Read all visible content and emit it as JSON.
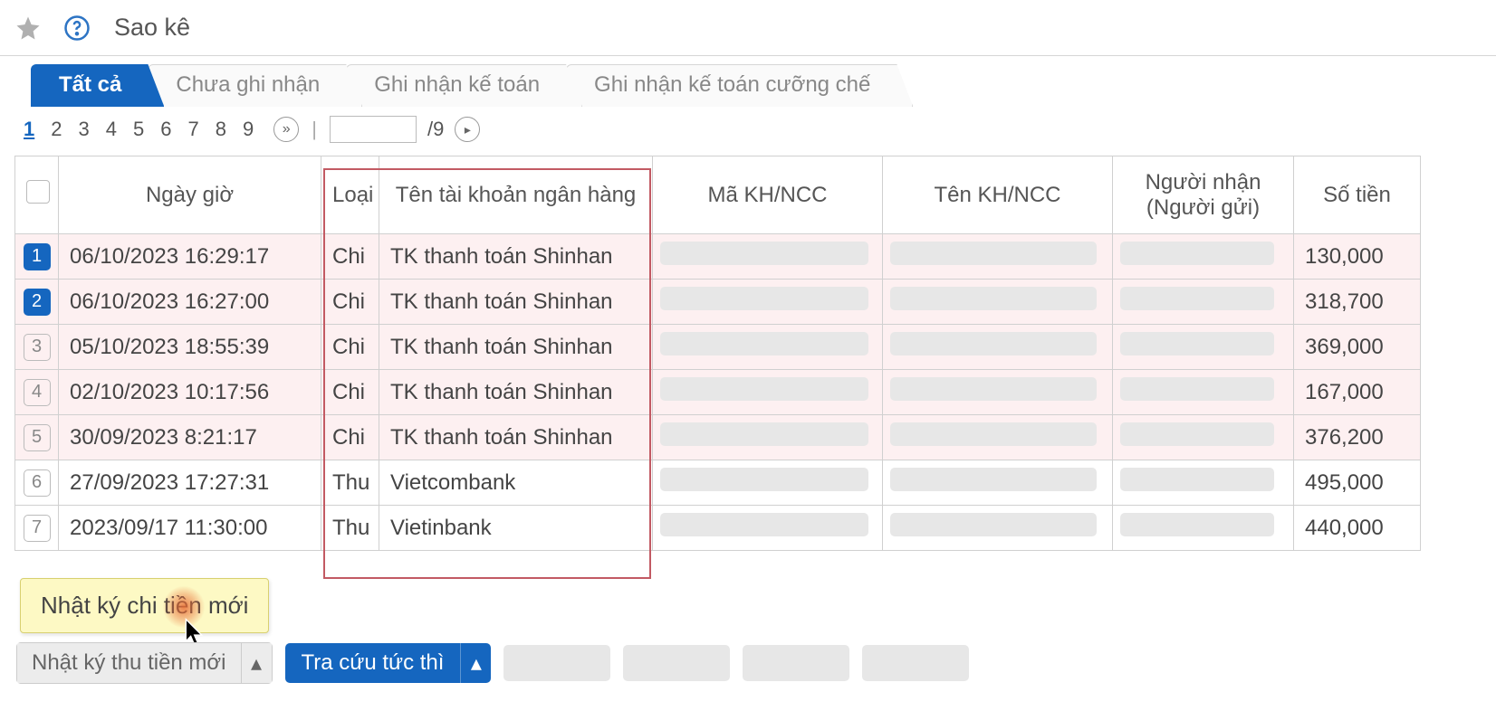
{
  "header": {
    "title": "Sao kê"
  },
  "tabs": [
    "Tất cả",
    "Chưa ghi nhận",
    "Ghi nhận kế toán",
    "Ghi nhận kế toán cưỡng chế"
  ],
  "pagination": {
    "pages": [
      "1",
      "2",
      "3",
      "4",
      "5",
      "6",
      "7",
      "8",
      "9"
    ],
    "active": "1",
    "total": "9",
    "input_value": ""
  },
  "table": {
    "headers": {
      "date": "Ngày giờ",
      "type": "Loại",
      "bank": "Tên tài khoản ngân hàng",
      "code": "Mã KH/NCC",
      "name": "Tên KH/NCC",
      "recv": "Người nhận (Người gửi)",
      "amt": "Số tiền"
    },
    "rows": [
      {
        "n": "1",
        "sel": true,
        "pink": true,
        "date": "06/10/2023 16:29:17",
        "type": "Chi",
        "bank": "TK thanh toán Shinhan",
        "amt": "130,000"
      },
      {
        "n": "2",
        "sel": true,
        "pink": true,
        "date": "06/10/2023 16:27:00",
        "type": "Chi",
        "bank": "TK thanh toán Shinhan",
        "amt": "318,700"
      },
      {
        "n": "3",
        "sel": false,
        "pink": true,
        "date": "05/10/2023 18:55:39",
        "type": "Chi",
        "bank": "TK thanh toán Shinhan",
        "amt": "369,000"
      },
      {
        "n": "4",
        "sel": false,
        "pink": true,
        "date": "02/10/2023 10:17:56",
        "type": "Chi",
        "bank": "TK thanh toán Shinhan",
        "amt": "167,000"
      },
      {
        "n": "5",
        "sel": false,
        "pink": true,
        "date": "30/09/2023 8:21:17",
        "type": "Chi",
        "bank": "TK thanh toán Shinhan",
        "amt": "376,200"
      },
      {
        "n": "6",
        "sel": false,
        "pink": false,
        "date": "27/09/2023 17:27:31",
        "type": "Thu",
        "bank": "Vietcombank",
        "amt": "495,000"
      },
      {
        "n": "7",
        "sel": false,
        "pink": false,
        "date": "2023/09/17 11:30:00",
        "type": "Thu",
        "bank": "Vietinbank",
        "amt": "440,000"
      }
    ]
  },
  "popup": {
    "item": "Nhật ký chi tiền mới"
  },
  "footer": {
    "gray_label": "Nhật ký thu tiền mới",
    "blue_label": "Tra cứu tức thì"
  }
}
